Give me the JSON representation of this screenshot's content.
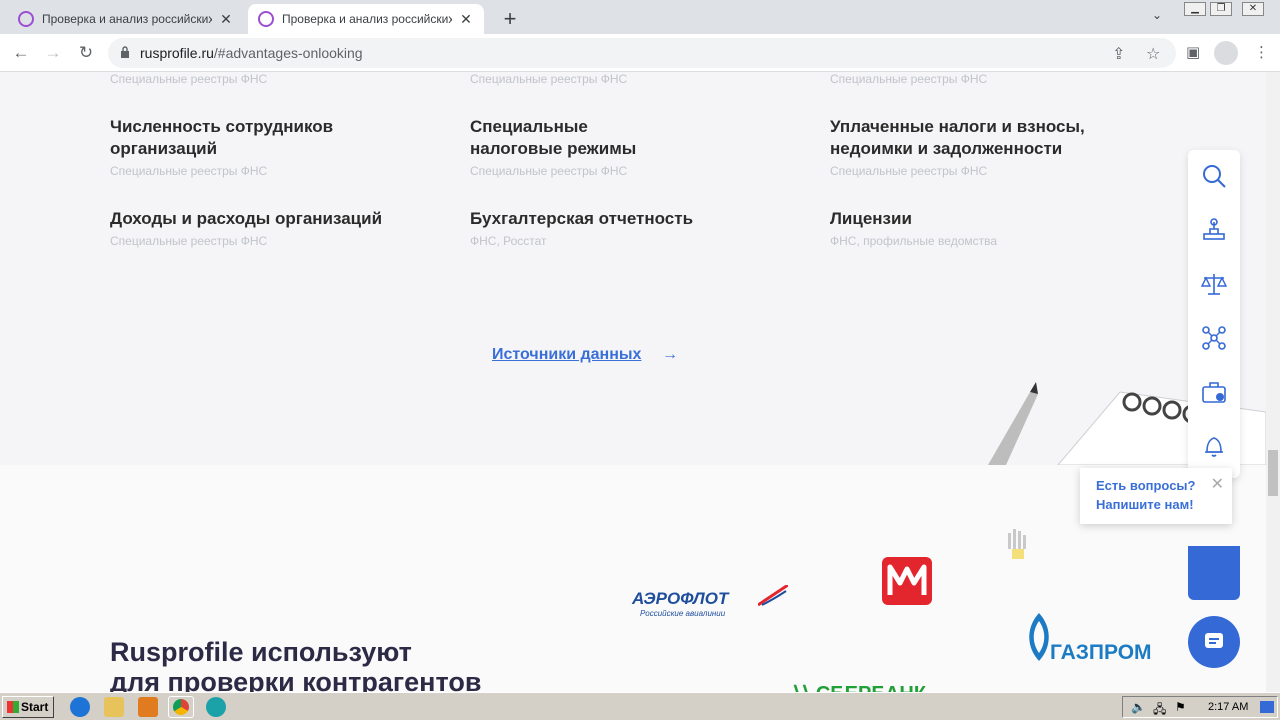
{
  "browser": {
    "tabs": [
      {
        "title": "Проверка и анализ российских юр",
        "active": false
      },
      {
        "title": "Проверка и анализ российских юр",
        "active": true
      }
    ],
    "url_host": "rusprofile.ru",
    "url_path": "/#advantages-onlooking"
  },
  "features": {
    "top_subs": [
      "Специальные реестры ФНС",
      "Специальные реестры ФНС",
      "Специальные реестры ФНС"
    ],
    "row1": [
      {
        "title_l1": "Численность сотрудников",
        "title_l2": "организаций",
        "source": "Специальные реестры ФНС"
      },
      {
        "title_l1": "Специальные",
        "title_l2": "налоговые режимы",
        "source": "Специальные реестры ФНС"
      },
      {
        "title_l1": "Уплаченные налоги и взносы,",
        "title_l2": "недоимки и задолженности",
        "source": "Специальные реестры ФНС"
      }
    ],
    "row2": [
      {
        "title": "Доходы и расходы организаций",
        "source": "Специальные реестры ФНС"
      },
      {
        "title": "Бухгалтерская отчетность",
        "source": "ФНС, Росстат"
      },
      {
        "title": "Лицензии",
        "source": "ФНС, профильные ведомства"
      }
    ]
  },
  "sources_link": {
    "label": "Источники данных",
    "arrow": "→"
  },
  "clients": {
    "heading_l1": "Rusprofile используют",
    "heading_l2": "для проверки контрагентов",
    "logos": {
      "aeroflot": "АЭРОФЛОТ",
      "aeroflot_sub": "Российские авиалинии",
      "gazprom": "ГАЗПРОМ",
      "sber": "СБЕРБАНК"
    }
  },
  "chat": {
    "line1": "Есть вопросы?",
    "line2": "Напишите нам!"
  },
  "taskbar": {
    "start": "Start",
    "time": "2:17 AM"
  },
  "colors": {
    "accent": "#3469d6",
    "link": "#3a6fd8",
    "gray_bg": "#f5f5f7"
  }
}
